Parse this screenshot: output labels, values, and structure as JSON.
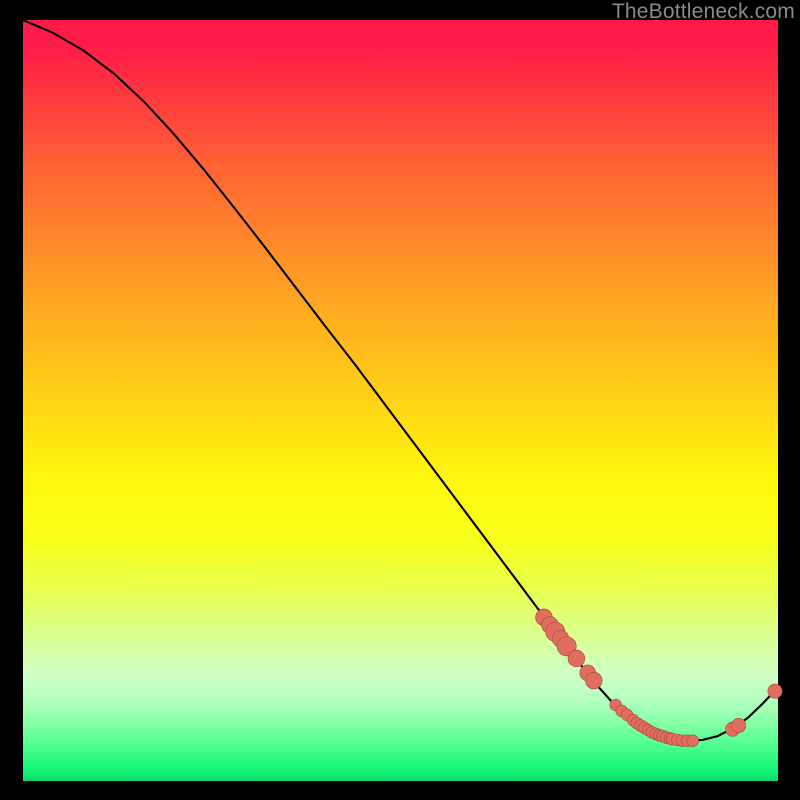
{
  "watermark": "TheBottleneck.com",
  "colors": {
    "background": "#000000",
    "curve": "#000000",
    "marker_fill": "#e06d5e",
    "marker_stroke": "#a84a3d"
  },
  "chart_data": {
    "type": "line",
    "title": "",
    "xlabel": "",
    "ylabel": "",
    "xlim": [
      0,
      100
    ],
    "ylim": [
      0,
      100
    ],
    "grid": false,
    "legend": false,
    "x": [
      0,
      4,
      8,
      12,
      16,
      20,
      24,
      28,
      32,
      36,
      40,
      44,
      48,
      52,
      56,
      60,
      64,
      68,
      70,
      72,
      74,
      76,
      78,
      80,
      82,
      84,
      86,
      88,
      90,
      92,
      94,
      96,
      98,
      100
    ],
    "y": [
      100,
      98.3,
      96.0,
      93.0,
      89.3,
      85.0,
      80.3,
      75.3,
      70.2,
      65.0,
      59.8,
      54.7,
      49.4,
      44.1,
      38.8,
      33.5,
      28.2,
      22.9,
      20.3,
      17.7,
      15.1,
      12.6,
      10.4,
      8.6,
      7.2,
      6.1,
      5.5,
      5.3,
      5.4,
      5.9,
      6.9,
      8.3,
      10.2,
      12.3
    ],
    "markers": [
      {
        "x": 69.0,
        "y": 21.5,
        "r": 1.3
      },
      {
        "x": 69.8,
        "y": 20.5,
        "r": 1.3
      },
      {
        "x": 70.5,
        "y": 19.6,
        "r": 1.6
      },
      {
        "x": 71.2,
        "y": 18.7,
        "r": 1.3
      },
      {
        "x": 72.0,
        "y": 17.7,
        "r": 1.6
      },
      {
        "x": 73.3,
        "y": 16.1,
        "r": 1.3
      },
      {
        "x": 74.8,
        "y": 14.2,
        "r": 1.2
      },
      {
        "x": 75.6,
        "y": 13.2,
        "r": 1.3
      },
      {
        "x": 78.5,
        "y": 10.0,
        "r": 0.7
      },
      {
        "x": 79.3,
        "y": 9.2,
        "r": 0.7
      },
      {
        "x": 80.0,
        "y": 8.7,
        "r": 0.7
      },
      {
        "x": 80.8,
        "y": 8.0,
        "r": 0.7
      },
      {
        "x": 81.3,
        "y": 7.6,
        "r": 0.7
      },
      {
        "x": 81.8,
        "y": 7.3,
        "r": 0.7
      },
      {
        "x": 82.3,
        "y": 7.0,
        "r": 0.7
      },
      {
        "x": 82.8,
        "y": 6.7,
        "r": 0.7
      },
      {
        "x": 83.3,
        "y": 6.4,
        "r": 0.7
      },
      {
        "x": 83.8,
        "y": 6.2,
        "r": 0.7
      },
      {
        "x": 84.3,
        "y": 6.0,
        "r": 0.7
      },
      {
        "x": 84.7,
        "y": 5.9,
        "r": 0.7
      },
      {
        "x": 85.2,
        "y": 5.7,
        "r": 0.7
      },
      {
        "x": 85.7,
        "y": 5.6,
        "r": 0.7
      },
      {
        "x": 86.0,
        "y": 5.5,
        "r": 0.7
      },
      {
        "x": 86.7,
        "y": 5.4,
        "r": 0.7
      },
      {
        "x": 87.3,
        "y": 5.3,
        "r": 0.7
      },
      {
        "x": 88.0,
        "y": 5.3,
        "r": 0.7
      },
      {
        "x": 88.7,
        "y": 5.3,
        "r": 0.7
      },
      {
        "x": 94.0,
        "y": 6.8,
        "r": 1.0
      },
      {
        "x": 94.8,
        "y": 7.3,
        "r": 1.0
      },
      {
        "x": 99.6,
        "y": 11.8,
        "r": 1.0
      }
    ]
  }
}
